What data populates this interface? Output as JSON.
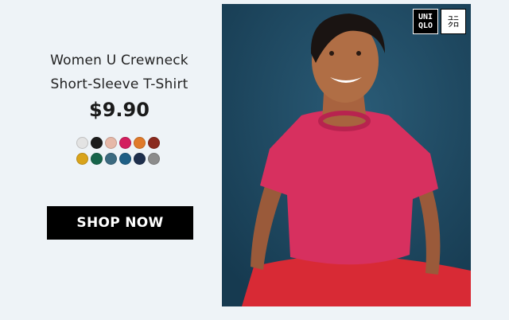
{
  "product": {
    "title_line1": "Women U Crewneck",
    "title_line2": "Short-Sleeve T-Shirt",
    "price": "$9.90"
  },
  "swatches": [
    [
      "#e3e3e3",
      "#1c1c1c",
      "#e6b8a8",
      "#d31f5f",
      "#e07a2a",
      "#8a2a1e"
    ],
    [
      "#d9a31a",
      "#16644a",
      "#3b6a80",
      "#1e5f86",
      "#1e2f4d",
      "#8c8c8c"
    ]
  ],
  "cta": {
    "label": "SHOP NOW"
  },
  "brand": {
    "logo_text": "UNI\nQLO",
    "logo_alt_text": "ユニ\nクロ"
  },
  "photo": {
    "subject": "woman wearing pink crewneck t-shirt",
    "background_color": "#1f4a63",
    "shirt_color": "#d7305f"
  }
}
